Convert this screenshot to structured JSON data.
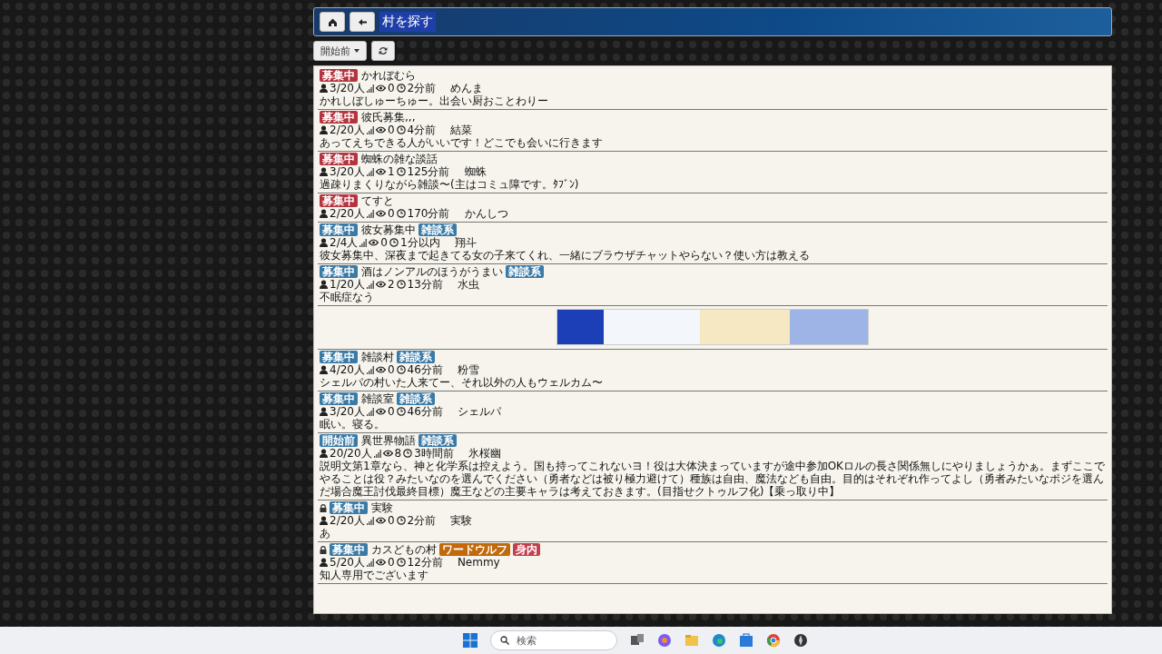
{
  "header": {
    "title": "村を探す",
    "buttons": [
      {
        "kind": "home"
      },
      {
        "kind": "back"
      }
    ]
  },
  "toolbar": {
    "filter_label": "開始前"
  },
  "rooms": [
    {
      "kind": "room",
      "locked": false,
      "status": {
        "label": "募集中",
        "color": "#b3343f"
      },
      "title": "かれぼむら",
      "members": "3/20人",
      "watchers": "0",
      "time": "2分前",
      "host": "めんま",
      "description": "かれしぼしゅーちゅー。出会い厨おことわりー"
    },
    {
      "kind": "room",
      "locked": false,
      "status": {
        "label": "募集中",
        "color": "#b3343f"
      },
      "title": "彼氏募集,,,",
      "members": "2/20人",
      "watchers": "0",
      "time": "4分前",
      "host": "結菜",
      "description": "あってえちできる人がいいです！どこでも会いに行きます"
    },
    {
      "kind": "room",
      "locked": false,
      "status": {
        "label": "募集中",
        "color": "#b3343f"
      },
      "title": "蜘蛛の雑な談話",
      "members": "3/20人",
      "watchers": "1",
      "time": "125分前",
      "host": "蜘蛛",
      "description": "過疎りまくりながら雑談〜(主はコミュ障です。ﾀﾌﾞﾝ)"
    },
    {
      "kind": "room",
      "locked": false,
      "status": {
        "label": "募集中",
        "color": "#b3343f"
      },
      "title": "てすと",
      "members": "2/20人",
      "watchers": "0",
      "time": "170分前",
      "host": "かんしつ"
    },
    {
      "kind": "room",
      "locked": false,
      "status": {
        "label": "募集中",
        "color": "#3a7aa6"
      },
      "title": "彼女募集中",
      "tags": [
        {
          "label": "雑談系",
          "color": "#3a7aa6"
        }
      ],
      "members": "2/4人",
      "watchers": "0",
      "time": "1分以内",
      "host": "翔斗",
      "description": "彼女募集中、深夜まで起きてる女の子来てくれ、一緒にブラウザチャットやらない？使い方は教える"
    },
    {
      "kind": "room",
      "locked": false,
      "status": {
        "label": "募集中",
        "color": "#3a7aa6"
      },
      "title": "酒はノンアルのほうがうまい",
      "tags": [
        {
          "label": "雑談系",
          "color": "#3a7aa6"
        }
      ],
      "members": "1/20人",
      "watchers": "2",
      "time": "13分前",
      "host": "水虫",
      "description": "不眠症なう"
    },
    {
      "kind": "ad"
    },
    {
      "kind": "room",
      "locked": false,
      "status": {
        "label": "募集中",
        "color": "#3a7aa6"
      },
      "title": "雑談村",
      "tags": [
        {
          "label": "雑談系",
          "color": "#3a7aa6"
        }
      ],
      "members": "4/20人",
      "watchers": "0",
      "time": "46分前",
      "host": "粉雪",
      "description": "シェルパの村いた人来てー、それ以外の人もウェルカム〜"
    },
    {
      "kind": "room",
      "locked": false,
      "status": {
        "label": "募集中",
        "color": "#3a7aa6"
      },
      "title": "雑談室",
      "tags": [
        {
          "label": "雑談系",
          "color": "#3a7aa6"
        }
      ],
      "members": "3/20人",
      "watchers": "0",
      "time": "46分前",
      "host": "シェルパ",
      "description": "眠い。寝る。"
    },
    {
      "kind": "room",
      "locked": false,
      "status": {
        "label": "開始前",
        "color": "#3a7aa6"
      },
      "title": "異世界物語",
      "tags": [
        {
          "label": "雑談系",
          "color": "#3a7aa6"
        }
      ],
      "members": "20/20人",
      "watchers": "8",
      "time": "3時間前",
      "host": "氷桜幽",
      "description": "説明文第1章なら、神と化学系は控えよう。国も持ってこれないヨ！役は大体決まっていますが途中参加OKロルの長さ関係無しにやりましょうかぁ。まずここでやることは役？みたいなのを選んでください（勇者などは被り極力避けて）種族は自由、魔法なども自由。目的はそれぞれ作ってよし（勇者みたいなポジを選んだ場合魔王討伐最終目標）魔王などの主要キャラは考えておきます。(目指せクトゥルフ化)【乗っ取り中】"
    },
    {
      "kind": "room",
      "locked": true,
      "status": {
        "label": "募集中",
        "color": "#3a7aa6"
      },
      "title": "実験",
      "members": "2/20人",
      "watchers": "0",
      "time": "2分前",
      "host": "実験",
      "description": "あ"
    },
    {
      "kind": "room",
      "locked": true,
      "status": {
        "label": "募集中",
        "color": "#3a7aa6"
      },
      "title": "カスどもの村",
      "tags": [
        {
          "label": "ワードウルフ",
          "color": "#c2690a"
        },
        {
          "label": "身内",
          "color": "#c2414e"
        }
      ],
      "members": "5/20人",
      "watchers": "0",
      "time": "12分前",
      "host": "Nemmy",
      "description": "知人専用でございます"
    }
  ],
  "taskbar": {
    "search_placeholder": "検索"
  }
}
